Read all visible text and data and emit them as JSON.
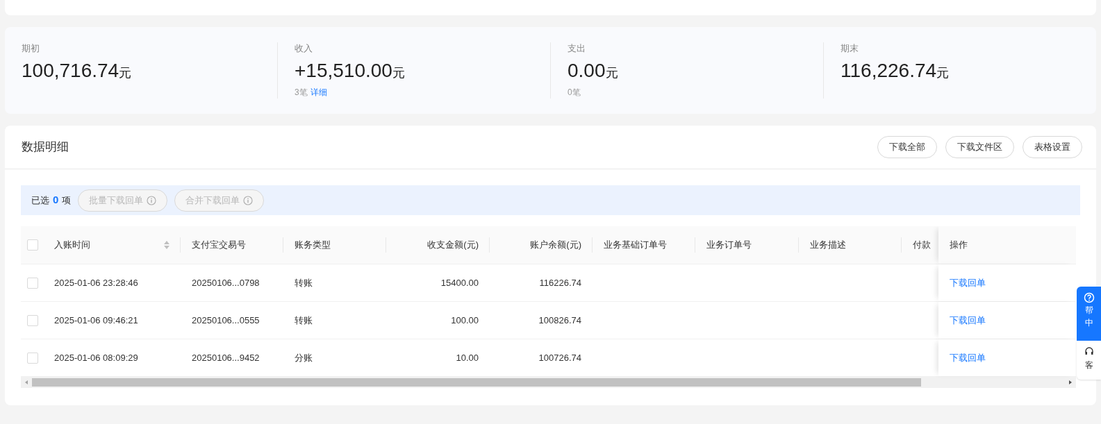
{
  "summary": [
    {
      "label": "期初",
      "amount": "100,716.74",
      "unit": "元"
    },
    {
      "label": "收入",
      "amount": "+15,510.00",
      "unit": "元",
      "count": "3笔",
      "link": "详细"
    },
    {
      "label": "支出",
      "amount": "0.00",
      "unit": "元",
      "count": "0笔"
    },
    {
      "label": "期末",
      "amount": "116,226.74",
      "unit": "元"
    }
  ],
  "detail": {
    "title": "数据明细",
    "buttons": [
      "下载全部",
      "下载文件区",
      "表格设置"
    ],
    "selection": {
      "prefix": "已选",
      "count": "0",
      "suffix": "项",
      "actions": [
        {
          "label": "批量下载回单",
          "disabled": true
        },
        {
          "label": "合并下载回单",
          "disabled": true
        }
      ]
    },
    "table": {
      "select_all": {
        "checked": false
      },
      "columns": [
        {
          "label": "入账时间",
          "sortable": true,
          "kind": "text"
        },
        {
          "label": "支付宝交易号",
          "sortable": false,
          "kind": "text"
        },
        {
          "label": "账务类型",
          "sortable": false,
          "kind": "text"
        },
        {
          "label": "收支金额(元)",
          "sortable": false,
          "kind": "amount"
        },
        {
          "label": "账户余额(元)",
          "sortable": false,
          "kind": "amount"
        },
        {
          "label": "业务基础订单号",
          "sortable": false,
          "kind": "text"
        },
        {
          "label": "业务订单号",
          "sortable": false,
          "kind": "text"
        },
        {
          "label": "业务描述",
          "sortable": false,
          "kind": "text"
        },
        {
          "label": "付款",
          "sortable": false,
          "kind": "text"
        }
      ],
      "action_column": "操作",
      "rows": [
        {
          "checked": false,
          "cells": [
            "2025-01-06 23:28:46",
            "20250106...0798",
            "转账",
            "15400.00",
            "116226.74"
          ],
          "action": "下载回单"
        },
        {
          "checked": false,
          "cells": [
            "2025-01-06 09:46:21",
            "20250106...0555",
            "转账",
            "100.00",
            "100826.74"
          ],
          "action": "下载回单"
        },
        {
          "checked": false,
          "cells": [
            "2025-01-06 08:09:29",
            "20250106...9452",
            "分账",
            "10.00",
            "100726.74"
          ],
          "action": "下载回单"
        }
      ]
    }
  },
  "side_widget": {
    "help": [
      "帮",
      "中"
    ],
    "service": "客"
  }
}
